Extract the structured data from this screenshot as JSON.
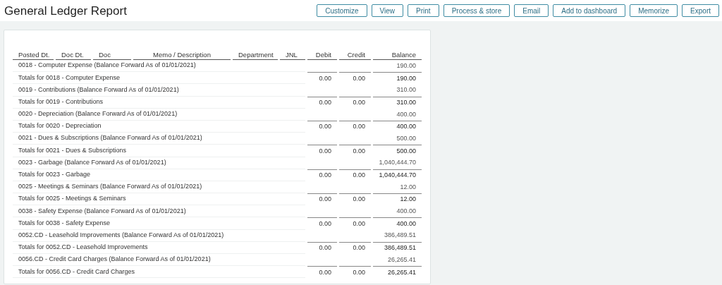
{
  "title": "General Ledger Report",
  "buttons": [
    "Customize",
    "View",
    "Print",
    "Process & store",
    "Email",
    "Add to dashboard",
    "Memorize",
    "Export"
  ],
  "columns": [
    "Posted Dt.",
    "Doc Dt.",
    "Doc",
    "Memo / Description",
    "Department",
    "JNL",
    "Debit",
    "Credit",
    "Balance"
  ],
  "rows": [
    {
      "kind": "forward",
      "description": "0018 - Computer Expense (Balance Forward As of 01/01/2021)",
      "balance": "190.00"
    },
    {
      "kind": "totals",
      "description": "Totals for 0018 - Computer Expense",
      "debit": "0.00",
      "credit": "0.00",
      "balance": "190.00"
    },
    {
      "kind": "forward",
      "description": "0019 - Contributions (Balance Forward As of 01/01/2021)",
      "balance": "310.00"
    },
    {
      "kind": "totals",
      "description": "Totals for 0019 - Contributions",
      "debit": "0.00",
      "credit": "0.00",
      "balance": "310.00"
    },
    {
      "kind": "forward",
      "description": "0020 - Depreciation (Balance Forward As of 01/01/2021)",
      "balance": "400.00"
    },
    {
      "kind": "totals",
      "description": "Totals for 0020 - Depreciation",
      "debit": "0.00",
      "credit": "0.00",
      "balance": "400.00"
    },
    {
      "kind": "forward",
      "description": "0021 - Dues & Subscriptions (Balance Forward As of 01/01/2021)",
      "balance": "500.00"
    },
    {
      "kind": "totals",
      "description": "Totals for 0021 - Dues & Subscriptions",
      "debit": "0.00",
      "credit": "0.00",
      "balance": "500.00"
    },
    {
      "kind": "forward",
      "description": "0023 - Garbage (Balance Forward As of 01/01/2021)",
      "balance": "1,040,444.70"
    },
    {
      "kind": "totals",
      "description": "Totals for 0023 - Garbage",
      "debit": "0.00",
      "credit": "0.00",
      "balance": "1,040,444.70"
    },
    {
      "kind": "forward",
      "description": "0025 - Meetings & Seminars (Balance Forward As of 01/01/2021)",
      "balance": "12.00"
    },
    {
      "kind": "totals",
      "description": "Totals for 0025 - Meetings & Seminars",
      "debit": "0.00",
      "credit": "0.00",
      "balance": "12.00"
    },
    {
      "kind": "forward",
      "description": "0038 - Safety Expense (Balance Forward As of 01/01/2021)",
      "balance": "400.00"
    },
    {
      "kind": "totals",
      "description": "Totals for 0038 - Safety Expense",
      "debit": "0.00",
      "credit": "0.00",
      "balance": "400.00"
    },
    {
      "kind": "forward",
      "description": "0052.CD - Leasehold Improvements (Balance Forward As of 01/01/2021)",
      "balance": "386,489.51"
    },
    {
      "kind": "totals",
      "description": "Totals for 0052.CD - Leasehold Improvements",
      "debit": "0.00",
      "credit": "0.00",
      "balance": "386,489.51"
    },
    {
      "kind": "forward",
      "description": "0056.CD - Credit Card Charges (Balance Forward As of 01/01/2021)",
      "balance": "26,265.41"
    },
    {
      "kind": "totals",
      "description": "Totals for 0056.CD - Credit Card Charges",
      "debit": "0.00",
      "credit": "0.00",
      "balance": "26,265.41"
    }
  ]
}
